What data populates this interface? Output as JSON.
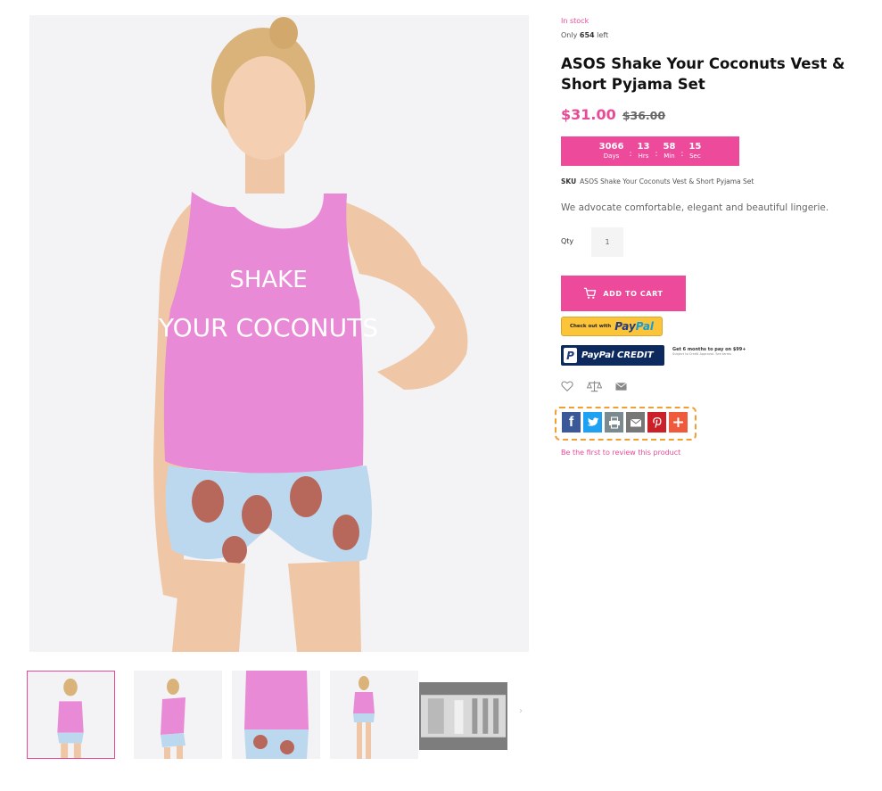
{
  "product": {
    "stock_status": "In stock",
    "only_prefix": "Only",
    "only_count": "654",
    "only_suffix": "left",
    "title": "ASOS Shake Your Coconuts Vest & Short Pyjama Set",
    "price": "$31.00",
    "old_price": "$36.00",
    "sku_label": "SKU",
    "sku_value": "ASOS Shake Your Coconuts Vest & Short Pyjama Set",
    "description": "We advocate comfortable, elegant and beautiful lingerie."
  },
  "countdown": {
    "days": "3066",
    "days_label": "Days",
    "hrs": "13",
    "hrs_label": "Hrs",
    "min": "58",
    "min_label": "Min",
    "sec": "15",
    "sec_label": "Sec",
    "separator": ":"
  },
  "cart": {
    "qty_label": "Qty",
    "qty_value": "1",
    "add_to_cart": "ADD TO CART"
  },
  "paypal": {
    "checkout_text": "Check out with",
    "logo_pay": "Pay",
    "logo_pal": "Pal",
    "credit_badge": "P",
    "credit_text": "PayPal CREDIT",
    "credit_note_line1": "Get 6 months to pay on $99+",
    "credit_note_line2": "Subject to Credit Approval. See terms"
  },
  "actions": {
    "wishlist_icon": "heart-icon",
    "compare_icon": "scale-icon",
    "email_icon": "envelope-icon"
  },
  "share": {
    "facebook": "f",
    "plus": "+"
  },
  "reviews": {
    "link_text": "Be the first to review this product"
  },
  "image": {
    "shirt_text_line1": "SHAKE",
    "shirt_text_line2": "YOUR COCONUTS"
  },
  "gallery": {
    "next_arrow": "›"
  },
  "colors": {
    "accent_pink": "#ee4a9c",
    "link_pink": "#e84b95",
    "share_highlight": "#f0a030",
    "facebook": "#3b5998",
    "twitter": "#1da1f2",
    "print": "#7b8a8f",
    "email": "#777777",
    "pinterest": "#cb2027",
    "more": "#f05a3c"
  }
}
